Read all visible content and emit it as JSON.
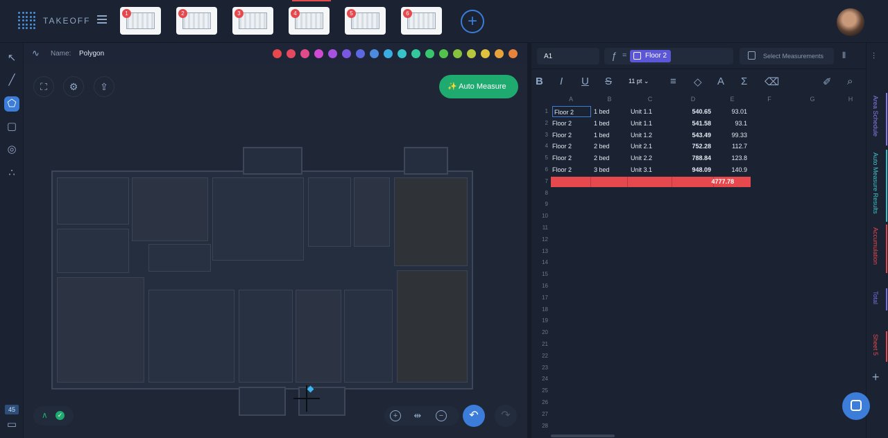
{
  "app": {
    "name": "TAKEOFF"
  },
  "sheets": [
    {
      "badge": "1"
    },
    {
      "badge": "2"
    },
    {
      "badge": "3"
    },
    {
      "badge": "4"
    },
    {
      "badge": "5"
    },
    {
      "badge": "6"
    }
  ],
  "properties": {
    "name_label": "Name:",
    "name_value": "Polygon"
  },
  "colors": [
    "#e5484d",
    "#e5485f",
    "#e04b8c",
    "#d04bd2",
    "#a652e0",
    "#7a57e0",
    "#5b68e0",
    "#4d8be0",
    "#3aaee0",
    "#36c2c8",
    "#35c79c",
    "#37c56e",
    "#53c24a",
    "#86c23e",
    "#b8c73c",
    "#e0c13d",
    "#e8a23c",
    "#e8833b"
  ],
  "canvas": {
    "auto_measure": "Auto Measure",
    "measure_count": "45"
  },
  "spreadsheet": {
    "cell_ref": "A1",
    "formula_eq": "=",
    "formula_chip": "Floor 2",
    "select_measurements": "Select Measurements",
    "font_size": "11 pt",
    "columns": [
      "A",
      "B",
      "C",
      "D",
      "E",
      "F",
      "G",
      "H"
    ],
    "rows": [
      {
        "num": "1",
        "a": "Floor 2",
        "b": "1 bed",
        "c": "Unit 1.1",
        "d": "540.65",
        "e": "93.01"
      },
      {
        "num": "2",
        "a": "Floor 2",
        "b": "1 bed",
        "c": "Unit 1.1",
        "d": "541.58",
        "e": "93.1"
      },
      {
        "num": "3",
        "a": "Floor 2",
        "b": "1 bed",
        "c": "Unit 1.2",
        "d": "543.49",
        "e": "99.33"
      },
      {
        "num": "4",
        "a": "Floor 2",
        "b": "2 bed",
        "c": "Unit 2.1",
        "d": "752.28",
        "e": "112.7"
      },
      {
        "num": "5",
        "a": "Floor 2",
        "b": "2 bed",
        "c": "Unit 2.2",
        "d": "788.84",
        "e": "123.8"
      },
      {
        "num": "6",
        "a": "Floor 2",
        "b": "3 bed",
        "c": "Unit 3.1",
        "d": "948.09",
        "e": "140.9"
      }
    ],
    "total": {
      "num": "7",
      "d": "4777.78"
    },
    "empty_rows": [
      "8",
      "9",
      "10",
      "11",
      "12",
      "13",
      "14",
      "15",
      "16",
      "17",
      "18",
      "19",
      "20",
      "21",
      "22",
      "23",
      "24",
      "25",
      "26",
      "27",
      "28"
    ]
  },
  "right_tabs": [
    {
      "label": "Area Schedule",
      "color": "#8a7be8"
    },
    {
      "label": "Auto Measure Results",
      "color": "#3ec3c8"
    },
    {
      "label": "Accumulation",
      "color": "#e5484d"
    },
    {
      "label": "Total",
      "color": "#7a6fe0"
    },
    {
      "label": "Sheet 5",
      "color": "#e5484d"
    }
  ]
}
